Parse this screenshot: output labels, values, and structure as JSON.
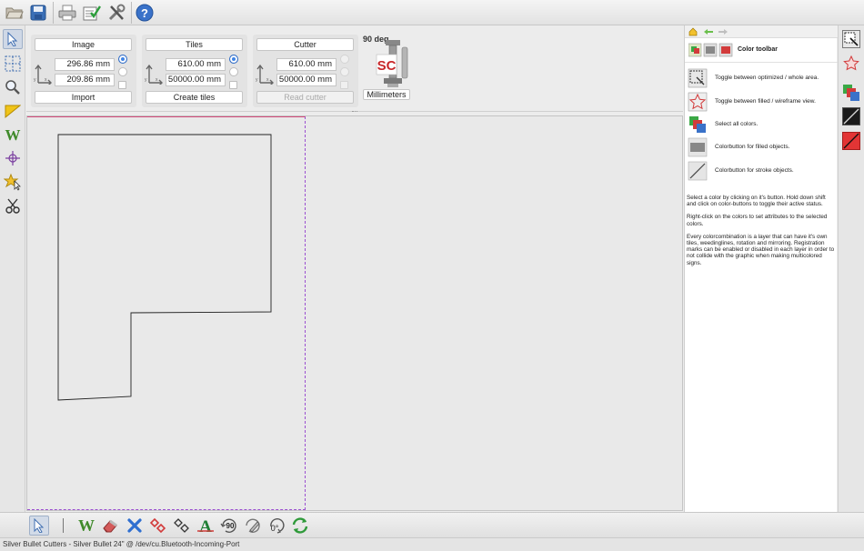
{
  "toolbar": {
    "icons": [
      "open-folder-icon",
      "save-disk-icon",
      "print-icon",
      "checklist-icon",
      "tools-icon",
      "help-icon"
    ]
  },
  "left_tools": {
    "icons": [
      "select-arrow-icon",
      "tile-selection-icon",
      "zoom-icon",
      "ruler-icon",
      "weed-w-icon",
      "registration-crosshair-icon",
      "star-select-icon",
      "scissors-icon"
    ]
  },
  "settings": {
    "image": {
      "title": "Image",
      "width": "296.86 mm",
      "height": "209.86 mm",
      "action": "Import"
    },
    "tiles": {
      "title": "Tiles",
      "width": "610.00 mm",
      "height": "50000.00 mm",
      "action": "Create tiles"
    },
    "cutter": {
      "title": "Cutter",
      "width": "610.00 mm",
      "height": "50000.00 mm",
      "action": "Read cutter"
    },
    "rotation_label": "90 deg",
    "logo_text": "SC",
    "units": "Millimeters"
  },
  "right_panel": {
    "title": "Color toolbar",
    "rows": [
      {
        "icon": "optimize-area-icon",
        "text": "Toggle between optimized / whole area."
      },
      {
        "icon": "filled-wireframe-star-icon",
        "text": "Toggle between filled / wireframe view."
      },
      {
        "icon": "select-all-colors-icon",
        "text": "Select all colors."
      },
      {
        "icon": "filled-color-button-icon",
        "text": "Colorbutton for filled objects."
      },
      {
        "icon": "stroke-color-button-icon",
        "text": "Colorbutton for stroke objects."
      }
    ],
    "help": [
      "Select a color by clicking on it's button. Hold down shift and click on color-buttons to toggle their active status.",
      "Right-click on the colors to set attributes to the selected colors.",
      "Every colorcombination is a layer that can have it's own tiles, weedinglines, rotation and mirroring. Registration marks can be enabled or disabled in each layer in order to not collide with the graphic when making multicolored signs."
    ]
  },
  "far_right_tools": {
    "icons": [
      "optimize-area-icon",
      "wireframe-star-icon",
      "select-all-colors-icon",
      "black-stroke-color-icon",
      "red-stroke-color-icon"
    ]
  },
  "bottom_tools": {
    "icons": [
      "pointer-icon",
      "separator-line",
      "weed-w-icon",
      "eraser-icon",
      "delete-x-icon",
      "red-diamonds-icon",
      "outline-diamonds-icon",
      "text-a-icon",
      "rotate-90-icon",
      "rotate-pen-icon",
      "rotate-0-icon",
      "refresh-icon"
    ],
    "rotate90_label": "90",
    "rotate0_label": "0°"
  },
  "status": {
    "text": "Silver Bullet Cutters - Silver Bullet 24\" @ /dev/cu.Bluetooth-Incoming-Port"
  },
  "colors": {
    "accent": "#3f84e5",
    "tile_border": "#9b4fd0",
    "canvas": "#e9e9e9"
  }
}
